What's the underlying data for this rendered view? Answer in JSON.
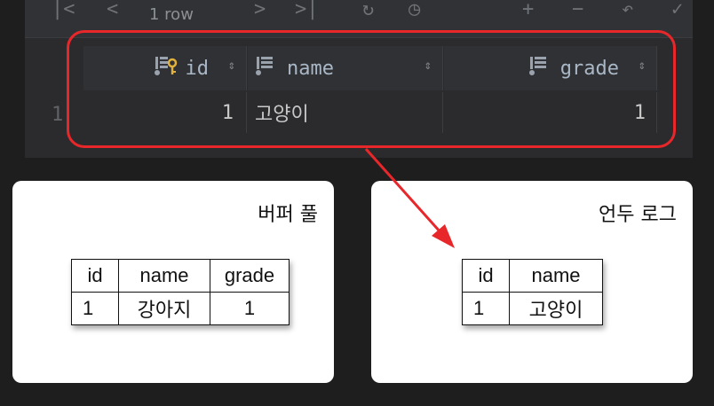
{
  "ide": {
    "toolbar": {
      "row_selector": "1 row"
    },
    "columns": [
      {
        "name": "id",
        "icon": "primary-key-column-icon"
      },
      {
        "name": "name",
        "icon": "column-icon"
      },
      {
        "name": "grade",
        "icon": "column-icon"
      }
    ],
    "row": {
      "number": "1",
      "id": "1",
      "name": "고양이",
      "grade": "1"
    }
  },
  "buffer_pool": {
    "title": "버퍼 풀",
    "headers": [
      "id",
      "name",
      "grade"
    ],
    "row": [
      "1",
      "강아지",
      "1"
    ]
  },
  "undo_log": {
    "title": "언두 로그",
    "headers": [
      "id",
      "name"
    ],
    "row": [
      "1",
      "고양이"
    ]
  },
  "colors": {
    "highlight": "#e8272a",
    "background": "#1e1e1f",
    "card": "#ffffff"
  }
}
